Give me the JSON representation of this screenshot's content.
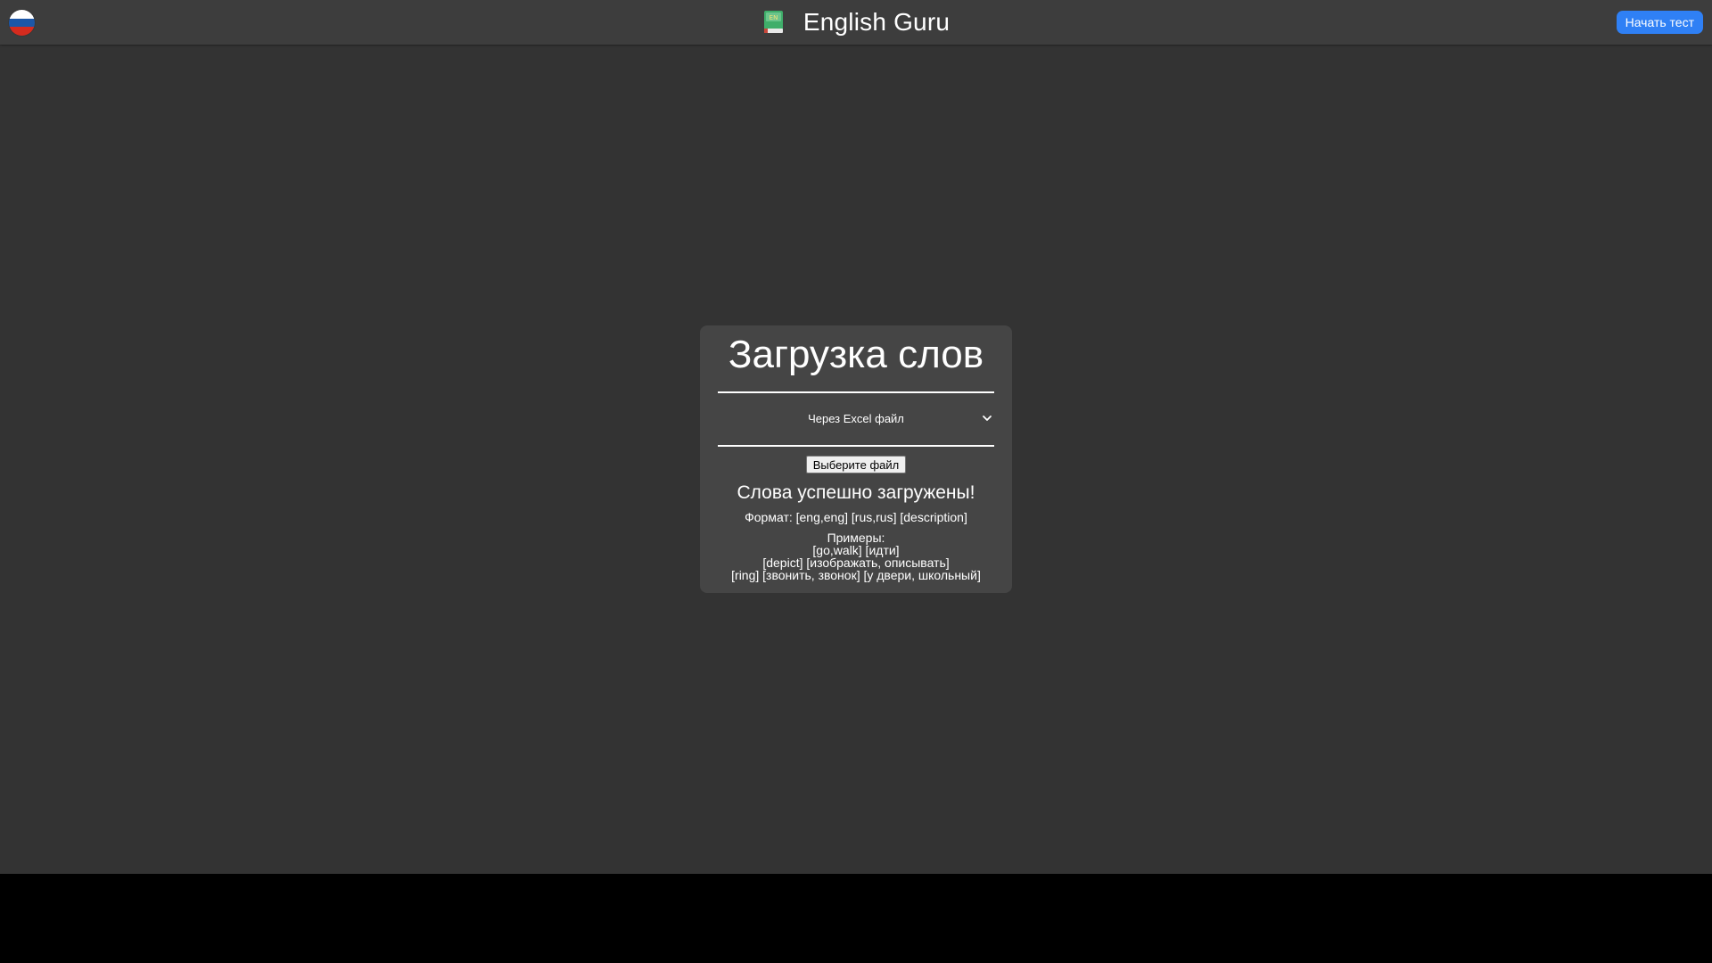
{
  "header": {
    "language_flag": "russia-flag-icon",
    "flag_colors": [
      "#ffffff",
      "#1c57a7",
      "#d52b1e"
    ],
    "brand_icon": "green-book-icon",
    "title": "English Guru",
    "start_test_label": "Начать тест",
    "accent_color": "#2f80f5"
  },
  "card": {
    "title": "Загрузка слов",
    "select": {
      "selected": "Через Excel файл"
    },
    "file_button_label": "Выберите файл",
    "success_message": "Слова успешно загружены!",
    "format_text": "Формат: [eng,eng] [rus,rus] [description]",
    "examples_heading": "Примеры:",
    "examples": [
      "[go,walk] [идти]",
      "[depict] [изображать, описывать]",
      "[ring] [звонить, звонок] [у двери, школьный]"
    ]
  }
}
